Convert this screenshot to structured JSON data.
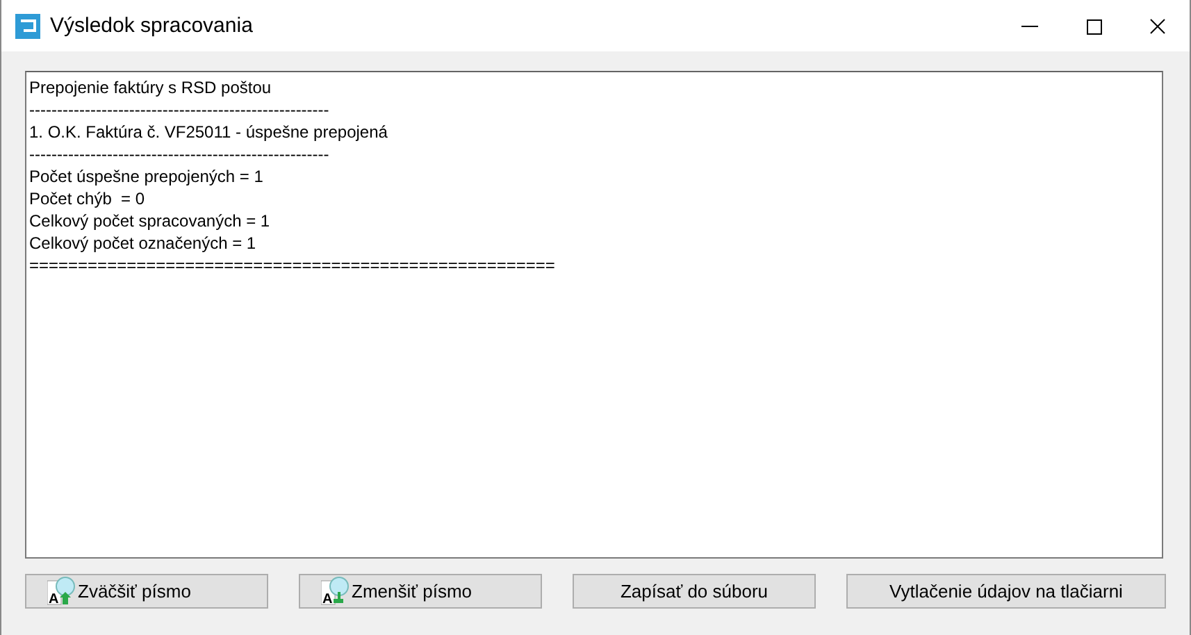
{
  "window": {
    "title": "Výsledok spracovania"
  },
  "output": {
    "lines": [
      "Prepojenie faktúry s RSD poštou",
      "------------------------------------------------------",
      "1. O.K. Faktúra č. VF25011 - úspešne prepojená",
      "------------------------------------------------------",
      "Počet úspešne prepojených = 1",
      "Počet chýb  = 0",
      "Celkový počet spracovaných = 1",
      "Celkový počet označených = 1",
      "======================================================"
    ]
  },
  "buttons": [
    {
      "label": "Zväčšiť písmo",
      "kind": "icon",
      "icon_letter": "A"
    },
    {
      "label": "Zmenšiť písmo",
      "kind": "icon",
      "icon_letter": "A"
    },
    {
      "label": "Zapísať do súboru",
      "kind": "plain"
    },
    {
      "label": "Vytlačenie údajov na tlačiarni",
      "kind": "plain"
    }
  ]
}
